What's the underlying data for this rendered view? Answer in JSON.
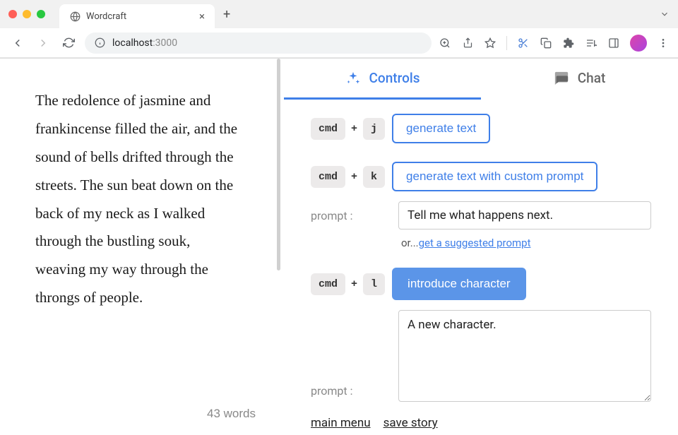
{
  "browser": {
    "tab_title": "Wordcraft",
    "address_host": "localhost",
    "address_port": ":3000"
  },
  "editor": {
    "text": " The redolence of jasmine and frankincense filled the air, and the sound of bells drifted through the streets. The sun beat down on the back of my neck as I walked through the bustling souk, weaving my way through the throngs of people.",
    "word_count": "43 words"
  },
  "tabs": {
    "controls": "Controls",
    "chat": "Chat"
  },
  "controls": {
    "key_cmd": "cmd",
    "key_plus": "+",
    "row1": {
      "key": "j",
      "action": "generate text"
    },
    "row2": {
      "key": "k",
      "action": "generate text with custom prompt",
      "prompt_label": "prompt :",
      "prompt_value": "Tell me what happens next.",
      "or_text": "or...",
      "suggest_link": "get a suggested prompt"
    },
    "row3": {
      "key": "l",
      "action": "introduce character",
      "prompt_label": "prompt :",
      "prompt_value": "A new character."
    }
  },
  "footer": {
    "main_menu": "main menu",
    "save_story": "save story"
  }
}
